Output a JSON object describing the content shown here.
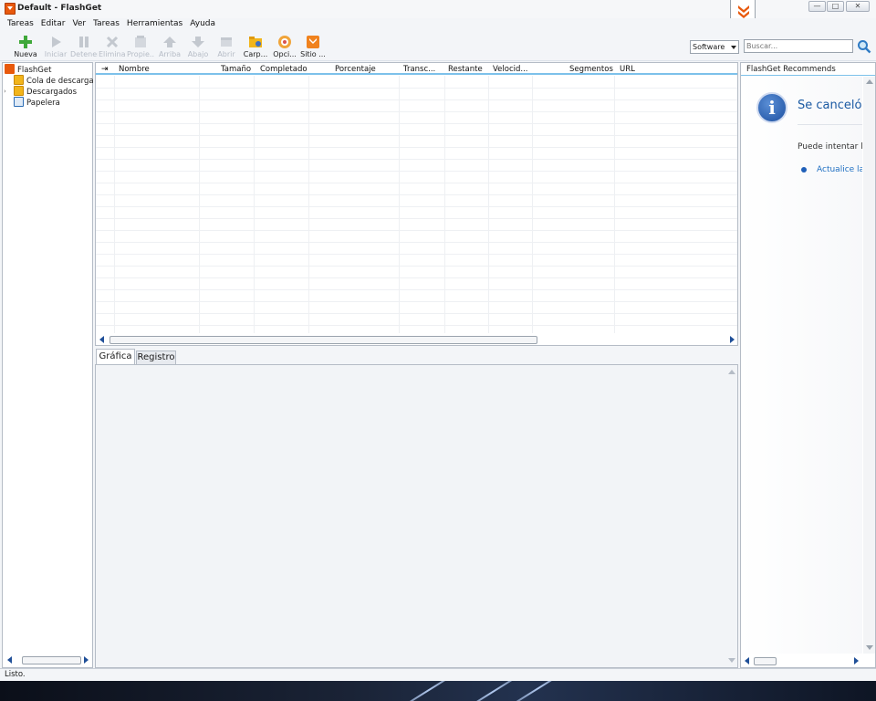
{
  "window": {
    "title": "Default - FlashGet",
    "minimize": "—",
    "maximize": "□",
    "close": "✕"
  },
  "menu": [
    "Tareas",
    "Editar",
    "Ver",
    "Tareas",
    "Herramientas",
    "Ayuda"
  ],
  "toolbar": {
    "buttons": [
      {
        "label": "Nueva",
        "icon": "add-icon",
        "enabled": true
      },
      {
        "label": "Iniciar",
        "icon": "play-icon",
        "enabled": false
      },
      {
        "label": "Detener",
        "icon": "pause-icon",
        "enabled": false
      },
      {
        "label": "Eliminar",
        "icon": "delete-icon",
        "enabled": false
      },
      {
        "label": "Propie...",
        "icon": "properties-icon",
        "enabled": false
      },
      {
        "label": "Arriba",
        "icon": "up-icon",
        "enabled": false
      },
      {
        "label": "Abajo",
        "icon": "down-icon",
        "enabled": false
      },
      {
        "label": "Abrir",
        "icon": "open-icon",
        "enabled": false
      },
      {
        "label": "Carp...",
        "icon": "folder-icon",
        "enabled": true
      },
      {
        "label": "Opci...",
        "icon": "options-icon",
        "enabled": true
      },
      {
        "label": "Sitio ...",
        "icon": "site-icon",
        "enabled": true
      }
    ],
    "category_value": "Software",
    "search_placeholder": "Buscar..."
  },
  "tree": {
    "root": "FlashGet",
    "items": [
      {
        "label": "Cola de descarga",
        "icon": "queue-folder-icon"
      },
      {
        "label": "Descargados",
        "icon": "downloaded-folder-icon"
      },
      {
        "label": "Papelera",
        "icon": "recycle-bin-icon"
      }
    ]
  },
  "task_list": {
    "columns": [
      "Nombre",
      "Tamaño",
      "Completado",
      "Porcentaje",
      "Transc...",
      "Restante",
      "Velocid...",
      "Segmentos",
      "URL"
    ],
    "rows": []
  },
  "detail_tabs": [
    "Gráfica",
    "Registro"
  ],
  "recommends": {
    "header": "FlashGet Recommends",
    "title": "Se canceló la",
    "text": "Puede intentar l",
    "link": "Actualice la"
  },
  "status": "Listo.",
  "colors": {
    "accent": "#7dc1ea",
    "brand": "#e8590c",
    "link": "#1f6fc2"
  }
}
